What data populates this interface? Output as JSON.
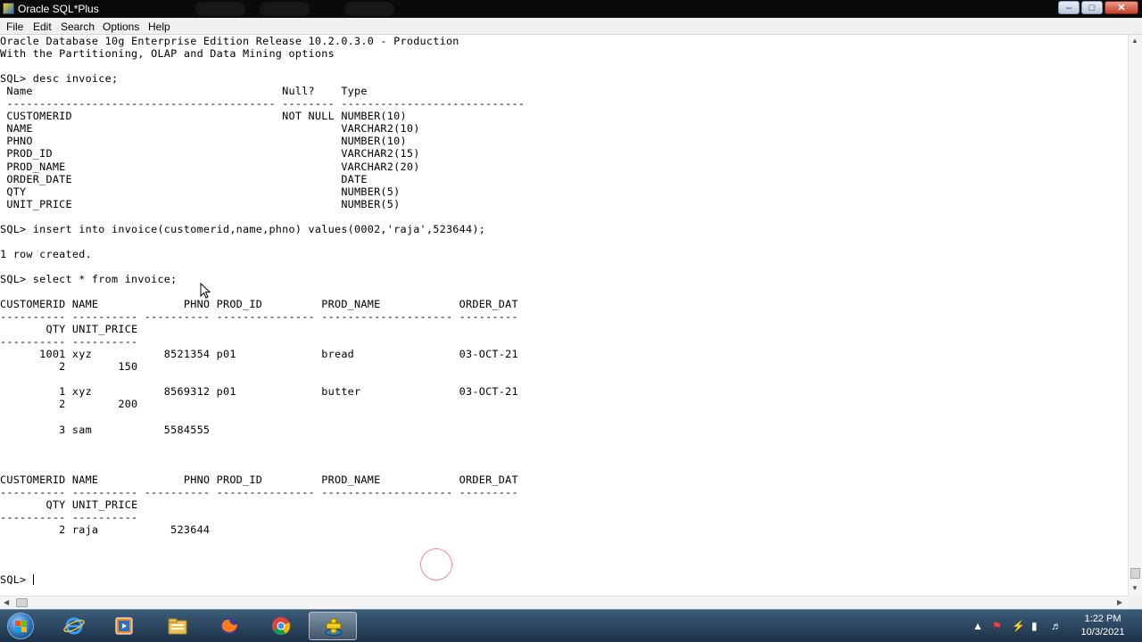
{
  "window": {
    "title": "Oracle SQL*Plus"
  },
  "menu": [
    "File",
    "Edit",
    "Search",
    "Options",
    "Help"
  ],
  "console": {
    "lines": [
      {
        "row": 0,
        "text": "Oracle Database 10g Enterprise Edition Release 10.2.0.3.0 - Production"
      },
      {
        "row": 1,
        "text": "With the Partitioning, OLAP and Data Mining options"
      },
      {
        "row": 3,
        "text": "SQL> desc invoice;"
      },
      {
        "row": 4,
        "text": " Name                                      Null?    Type"
      },
      {
        "row": 5,
        "text": " ----------------------------------------- -------- ----------------------------"
      },
      {
        "row": 6,
        "text": " CUSTOMERID                                NOT NULL NUMBER(10)"
      },
      {
        "row": 7,
        "text": " NAME                                               VARCHAR2(10)"
      },
      {
        "row": 8,
        "text": " PHNO                                               NUMBER(10)"
      },
      {
        "row": 9,
        "text": " PROD_ID                                            VARCHAR2(15)"
      },
      {
        "row": 10,
        "text": " PROD_NAME                                          VARCHAR2(20)"
      },
      {
        "row": 11,
        "text": " ORDER_DATE                                         DATE"
      },
      {
        "row": 12,
        "text": " QTY                                                NUMBER(5)"
      },
      {
        "row": 13,
        "text": " UNIT_PRICE                                         NUMBER(5)"
      },
      {
        "row": 15,
        "text": "SQL> insert into invoice(customerid,name,phno) values(0002,'raja',523644);"
      },
      {
        "row": 17,
        "text": "1 row created."
      },
      {
        "row": 19,
        "text": "SQL> select * from invoice;"
      },
      {
        "row": 21,
        "text": "CUSTOMERID NAME             PHNO PROD_ID         PROD_NAME            ORDER_DAT"
      },
      {
        "row": 22,
        "text": "---------- ---------- ---------- --------------- -------------------- ---------"
      },
      {
        "row": 23,
        "text": "       QTY UNIT_PRICE"
      },
      {
        "row": 24,
        "text": "---------- ----------"
      },
      {
        "row": 25,
        "text": "      1001 xyz           8521354 p01             bread                03-OCT-21"
      },
      {
        "row": 26,
        "text": "         2        150"
      },
      {
        "row": 28,
        "text": "         1 xyz           8569312 p01             butter               03-OCT-21"
      },
      {
        "row": 29,
        "text": "         2        200"
      },
      {
        "row": 31,
        "text": "         3 sam           5584555"
      },
      {
        "row": 35,
        "text": "CUSTOMERID NAME             PHNO PROD_ID         PROD_NAME            ORDER_DAT"
      },
      {
        "row": 36,
        "text": "---------- ---------- ---------- --------------- -------------------- ---------"
      },
      {
        "row": 37,
        "text": "       QTY UNIT_PRICE"
      },
      {
        "row": 38,
        "text": "---------- ----------"
      },
      {
        "row": 39,
        "text": "         2 raja           523644"
      },
      {
        "row": 43,
        "text": "SQL> "
      }
    ],
    "prompt_row": 43
  },
  "taskbar": {
    "items": [
      {
        "icon": "internet-explorer-icon"
      },
      {
        "icon": "media-player-icon"
      },
      {
        "icon": "file-explorer-icon"
      },
      {
        "icon": "firefox-icon"
      },
      {
        "icon": "chrome-icon"
      },
      {
        "icon": "sqlplus-icon",
        "active": true
      }
    ],
    "clock": {
      "time": "1:22 PM",
      "date": "10/3/2021"
    }
  }
}
